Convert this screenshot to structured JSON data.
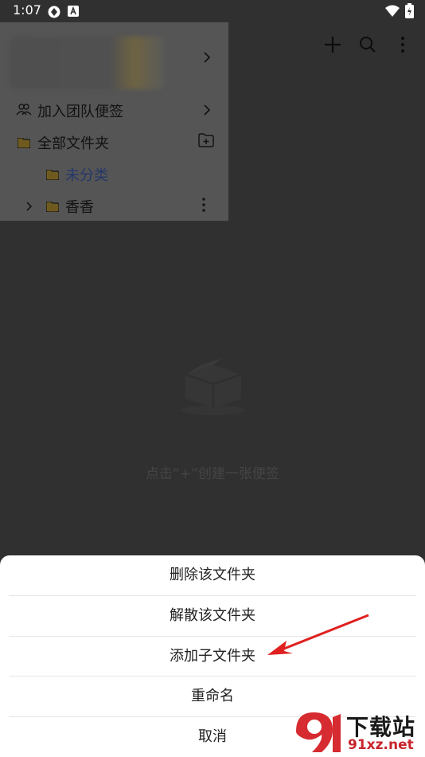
{
  "status_bar": {
    "time": "1:07"
  },
  "drawer": {
    "items": [
      {
        "label": "加入团队便签",
        "icon": "team-icon"
      },
      {
        "label": "全部文件夹",
        "icon": "folder-icon"
      },
      {
        "label": "未分类",
        "icon": "folder-icon",
        "selected": true
      },
      {
        "label": "香香",
        "icon": "folder-icon"
      }
    ]
  },
  "empty_state": {
    "text": "点击“+”创建一张便签"
  },
  "sheet": {
    "items": [
      {
        "label": "删除该文件夹"
      },
      {
        "label": "解散该文件夹"
      },
      {
        "label": "添加子文件夹"
      },
      {
        "label": "重命名"
      },
      {
        "label": "取消"
      }
    ]
  },
  "watermark": {
    "title": "下载站",
    "url": "91xz.net"
  },
  "colors": {
    "overlay": "#303030",
    "selected_label": "#253869",
    "arrow": "#e02020",
    "folder": "#6e5a1e"
  }
}
